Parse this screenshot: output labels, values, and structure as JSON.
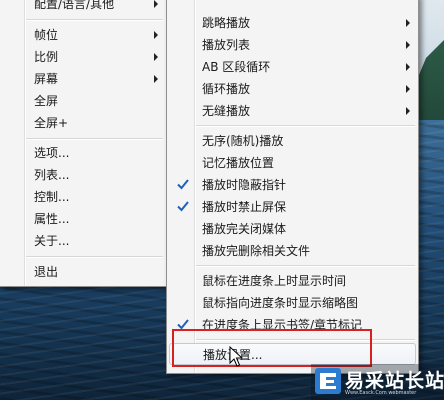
{
  "left_menu": {
    "items": [
      {
        "label": "配置/语言/其他",
        "arrow": true
      },
      {
        "label": "帧位",
        "arrow": true
      },
      {
        "label": "比例",
        "arrow": true
      },
      {
        "label": "屏幕",
        "arrow": true
      },
      {
        "label": "全屏",
        "arrow": false
      },
      {
        "label": "全屏+",
        "arrow": false
      },
      {
        "label": "选项...",
        "arrow": false
      },
      {
        "label": "列表...",
        "arrow": false
      },
      {
        "label": "控制...",
        "arrow": false
      },
      {
        "label": "属性...",
        "arrow": false
      },
      {
        "label": "关于...",
        "arrow": false
      },
      {
        "label": "退出",
        "arrow": false
      }
    ]
  },
  "right_menu": {
    "items": [
      {
        "label": "跳略播放",
        "arrow": true,
        "checked": false
      },
      {
        "label": "播放列表",
        "arrow": true,
        "checked": false
      },
      {
        "label": "AB 区段循环",
        "arrow": true,
        "checked": false
      },
      {
        "label": "循环播放",
        "arrow": true,
        "checked": false
      },
      {
        "label": "无缝播放",
        "arrow": true,
        "checked": false
      },
      {
        "label": "无序(随机)播放",
        "arrow": false,
        "checked": false
      },
      {
        "label": "记忆播放位置",
        "arrow": false,
        "checked": false
      },
      {
        "label": "播放时隐蔽指针",
        "arrow": false,
        "checked": true
      },
      {
        "label": "播放时禁止屏保",
        "arrow": false,
        "checked": true
      },
      {
        "label": "播放完关闭媒体",
        "arrow": false,
        "checked": false
      },
      {
        "label": "播放完删除相关文件",
        "arrow": false,
        "checked": false
      },
      {
        "label": "鼠标在进度条上时显示时间",
        "arrow": false,
        "checked": false
      },
      {
        "label": "鼠标指向进度条时显示缩略图",
        "arrow": false,
        "checked": false
      },
      {
        "label": "在进度条上显示书签/章节标记",
        "arrow": false,
        "checked": true
      },
      {
        "label": "播放设置...",
        "arrow": false,
        "checked": false,
        "hovered": true
      }
    ]
  },
  "watermark": {
    "text": "易采站长站",
    "subtext": "Www.Easck.Com webmaster"
  },
  "colors": {
    "check": "#1f5fbf",
    "highlight_box": "#d8201f",
    "menu_bg": "#f4f4f4"
  }
}
